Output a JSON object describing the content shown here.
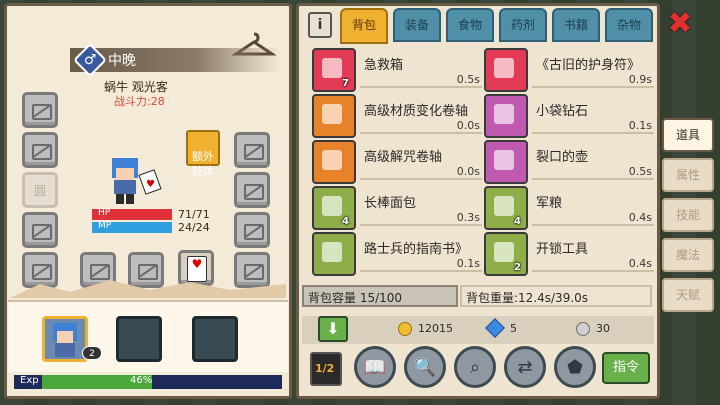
{
  "character": {
    "name": "中晚",
    "gender_symbol": "♂",
    "title": "蜗牛 观光客",
    "power": "战斗力:28",
    "extra_body_label": "额外\n肢体",
    "hp_label": "HP",
    "hp_value": "71/71",
    "hp_fraction": 1.0,
    "mp_label": "MP",
    "mp_value": "24/24",
    "mp_fraction": 1.0,
    "slot_disabled_label": "圆",
    "party_badge": "2",
    "exp_label": "Exp",
    "exp_value": "46%",
    "exp_fraction": 0.46
  },
  "bag": {
    "info_glyph": "i",
    "tabs": [
      "背包",
      "装备",
      "食物",
      "药剂",
      "书籍",
      "杂物"
    ],
    "active_tab": 0,
    "items": [
      {
        "name": "急救箱",
        "time": "0.5s",
        "count": "7",
        "icon": "first-aid-kit-icon",
        "color": "#e23b56"
      },
      {
        "name": "《古旧的护身符》",
        "time": "0.9s",
        "count": "",
        "icon": "amulet-icon",
        "color": "#e23b56"
      },
      {
        "name": "高级材质变化卷轴",
        "time": "0.0s",
        "count": "",
        "icon": "material-scroll-icon",
        "color": "#e8822a"
      },
      {
        "name": "小袋钻石",
        "time": "0.1s",
        "count": "",
        "icon": "diamond-pouch-icon",
        "color": "#c05ab0"
      },
      {
        "name": "高级解咒卷轴",
        "time": "0.0s",
        "count": "",
        "icon": "dispel-scroll-icon",
        "color": "#e8822a"
      },
      {
        "name": "裂口的壶",
        "time": "0.5s",
        "count": "",
        "icon": "cracked-pot-icon",
        "color": "#c05ab0"
      },
      {
        "name": "长棒面包",
        "time": "0.3s",
        "count": "4",
        "icon": "baguette-icon",
        "color": "#8fae4a"
      },
      {
        "name": "军粮",
        "time": "0.4s",
        "count": "4",
        "icon": "ration-icon",
        "color": "#8fae4a"
      },
      {
        "name": "路士兵的指南书》",
        "time": "0.1s",
        "count": "",
        "icon": "guide-book-icon",
        "color": "#8fae4a"
      },
      {
        "name": "开锁工具",
        "time": "0.4s",
        "count": "2",
        "icon": "lockpick-icon",
        "color": "#8fae4a"
      }
    ],
    "capacity_label": "背包容量 15/100",
    "weight_label": "背包重量:12.4s/39.0s",
    "gold": "12015",
    "gems": "5",
    "silver": "30",
    "page_badge": "1/2",
    "command_label": "指令"
  },
  "side_tabs": [
    "道具",
    "属性",
    "技能",
    "魔法",
    "天赋"
  ],
  "side_active": 0,
  "close_glyph": "✖",
  "colors": {
    "accent": "#f0b030",
    "tab": "#4f8fa8",
    "hp": "#e0303a",
    "mp": "#2f9fe0",
    "exp": "#6fbf3a"
  }
}
